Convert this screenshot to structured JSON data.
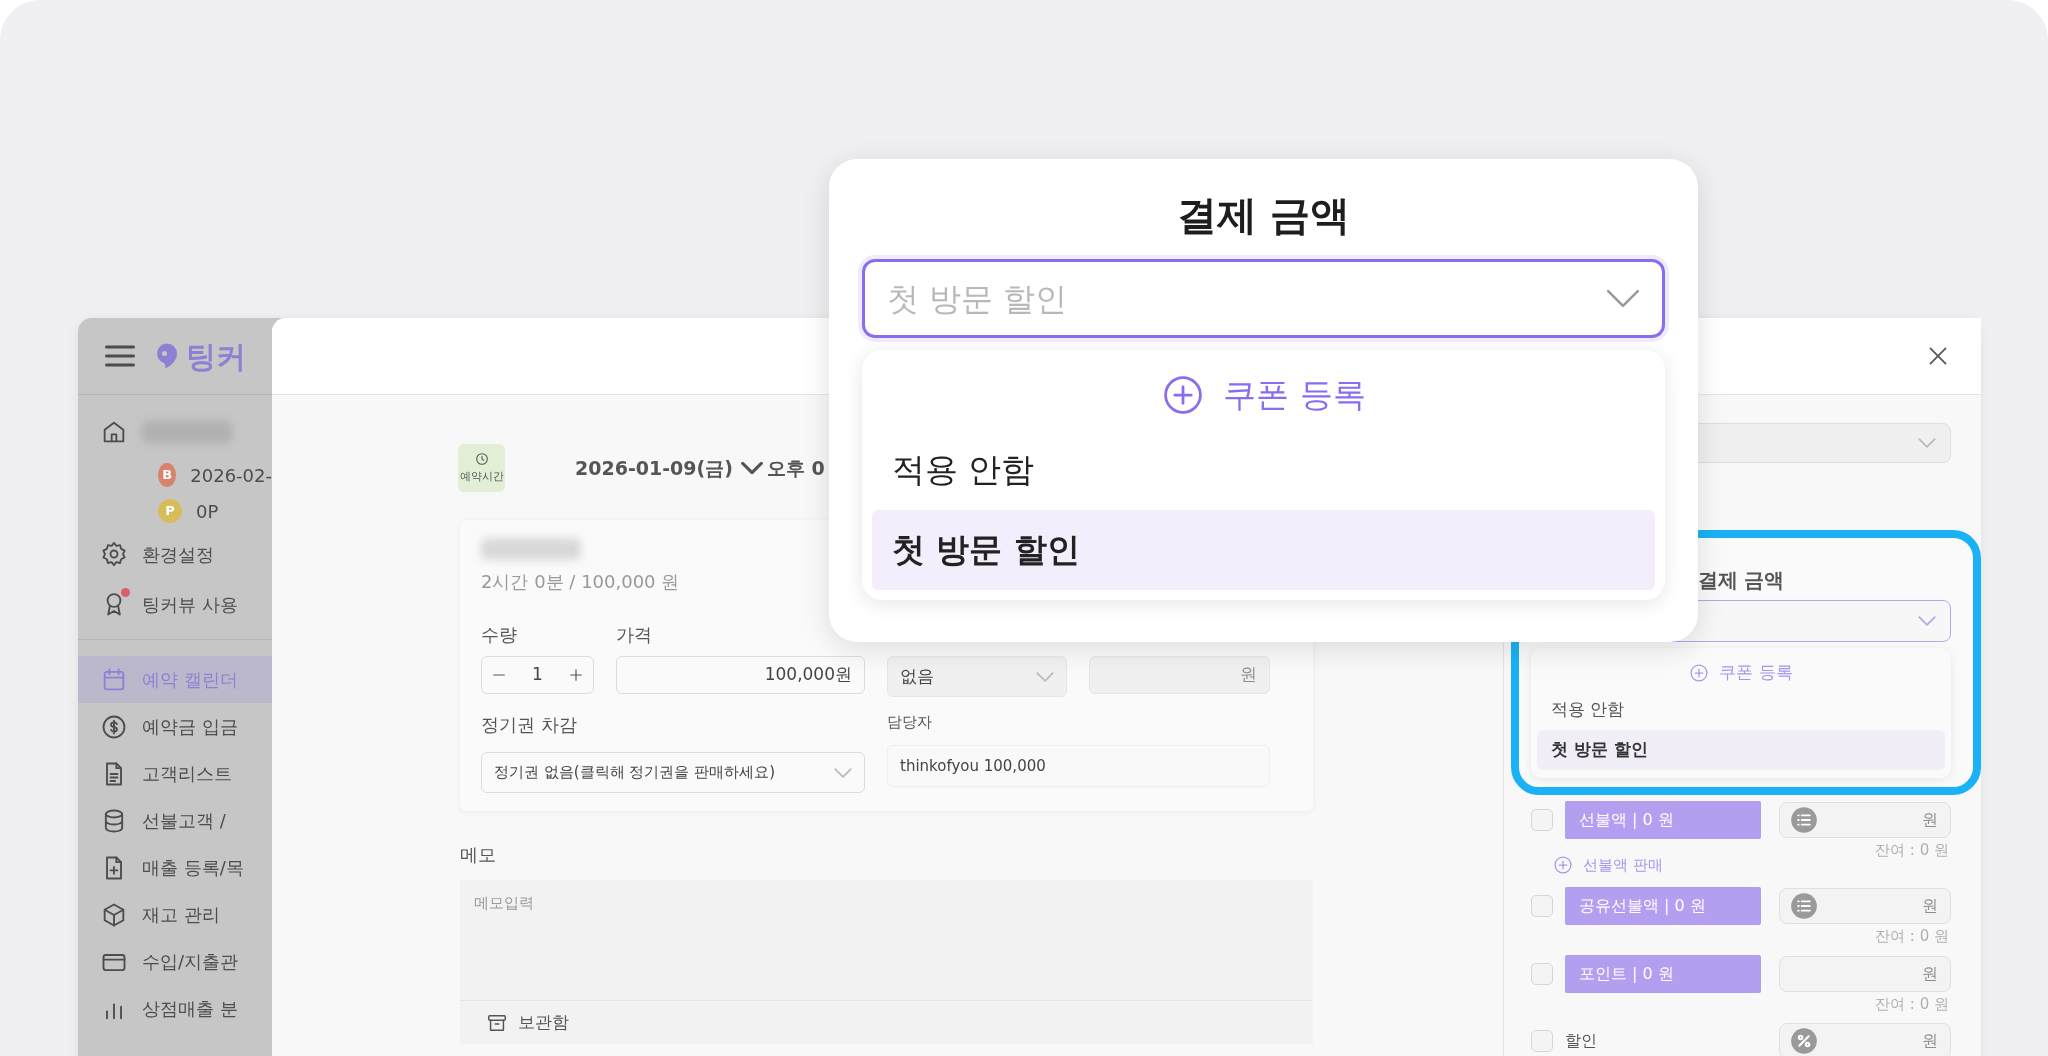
{
  "sidebar": {
    "brand": "팅커",
    "account": [
      {
        "badge": "B",
        "text": "2026-02-",
        "color": "#d9826e"
      },
      {
        "badge": "P",
        "text": "0P",
        "color": "#d8bc5a"
      }
    ],
    "top_items": [
      {
        "label": "환경설정",
        "notification": false
      },
      {
        "label": "팅커뷰 사용",
        "notification": true
      }
    ],
    "items": [
      {
        "label": "예약 캘린더",
        "selected": true
      },
      {
        "label": "예약금 입금",
        "selected": false
      },
      {
        "label": "고객리스트",
        "selected": false
      },
      {
        "label": "선불고객 /",
        "selected": false
      },
      {
        "label": "매출 등록/목",
        "selected": false
      },
      {
        "label": "재고 관리",
        "selected": false
      },
      {
        "label": "수입/지출관",
        "selected": false
      },
      {
        "label": "상점매출 분",
        "selected": false
      }
    ]
  },
  "modal": {
    "time_badge": "예약시간",
    "date": "2026-01-09(금)",
    "time": "오후 0",
    "service": {
      "summary": "2시간 0분 / 100,000 원"
    },
    "quantity": {
      "label": "수량",
      "value": "1"
    },
    "price": {
      "label": "가격",
      "value": "100,000원"
    },
    "option_select": {
      "value": "없음"
    },
    "amount_field": {
      "unit": "원"
    },
    "pass": {
      "label": "정기권 차감",
      "value": "정기권 없음(클릭해 정기권을 판매하세요)"
    },
    "staff": {
      "label": "담당자",
      "value": "thinkofyou 100,000"
    },
    "memo": {
      "label": "메모",
      "placeholder": "메모입력"
    },
    "archive": "보관함"
  },
  "payment_panel": {
    "title": "결제 금액",
    "add_label": "쿠폰 등록",
    "options": [
      {
        "label": "적용 안함",
        "selected": false
      },
      {
        "label": "첫 방문 할인",
        "selected": true
      }
    ],
    "rows": [
      {
        "kind": "balance",
        "label": "선불액 | 0 원",
        "checked": false,
        "menu_button": true,
        "unit": "원",
        "remaining": "잔여 : 0 원"
      },
      {
        "kind": "action",
        "label": "선불액 판매"
      },
      {
        "kind": "balance",
        "label": "공유선불액 | 0 원",
        "checked": false,
        "menu_button": true,
        "unit": "원",
        "remaining": "잔여 : 0 원"
      },
      {
        "kind": "balance",
        "label": "포인트 | 0 원",
        "checked": false,
        "menu_button": false,
        "unit": "원",
        "remaining": "잔여 : 0 원"
      },
      {
        "kind": "discount",
        "label": "할인",
        "checked": false,
        "unit": "원"
      }
    ]
  },
  "zoom_popup": {
    "title": "결제 금액",
    "select": {
      "placeholder": "첫 방문 할인"
    },
    "add_label": "쿠폰 등록",
    "options": [
      {
        "label": "적용 안함",
        "selected": false
      },
      {
        "label": "첫 방문 할인",
        "selected": true
      }
    ]
  }
}
